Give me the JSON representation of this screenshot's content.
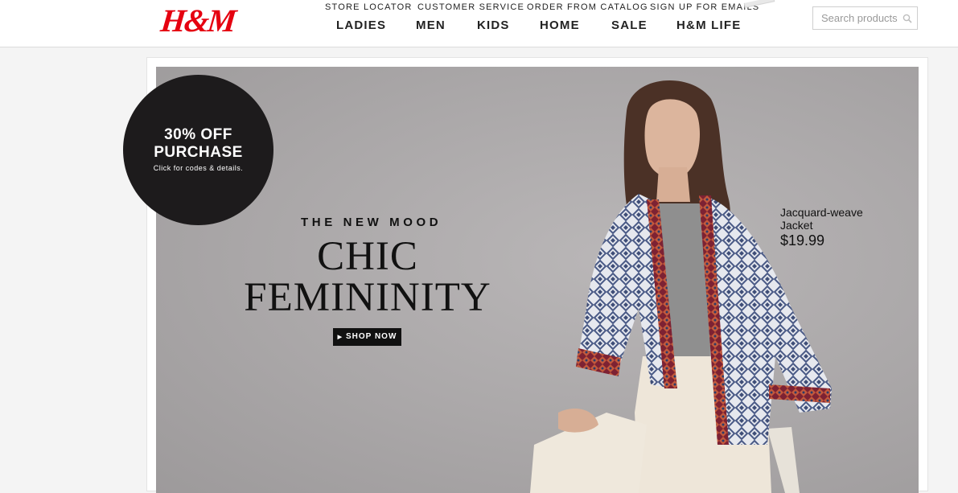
{
  "logo": {
    "text": "H&M"
  },
  "utility_nav": [
    {
      "label": "STORE LOCATOR"
    },
    {
      "label": "CUSTOMER SERVICE"
    },
    {
      "label": "ORDER FROM CATALOG"
    },
    {
      "label": "SIGN UP FOR EMAILS"
    }
  ],
  "main_nav": [
    {
      "label": "LADIES"
    },
    {
      "label": "MEN"
    },
    {
      "label": "KIDS"
    },
    {
      "label": "HOME"
    },
    {
      "label": "SALE"
    },
    {
      "label": "H&M LIFE"
    }
  ],
  "search": {
    "placeholder": "Search products",
    "icon": "search-icon"
  },
  "promo_badge": {
    "line1": "30% OFF",
    "line2": "PURCHASE",
    "line3": "Click for codes & details."
  },
  "hero": {
    "kicker": "THE NEW MOOD",
    "headline_line1": "CHIC",
    "headline_line2": "FEMININITY",
    "cta_label": "SHOP NOW",
    "cta_icon": "play-arrow-icon"
  },
  "product": {
    "name_line1": "Jacquard-weave",
    "name_line2": "Jacket",
    "price": "$19.99"
  },
  "colors": {
    "brand_red": "#e50010",
    "hero_background": "#aaa7a8",
    "badge": "#1d1b1c"
  }
}
